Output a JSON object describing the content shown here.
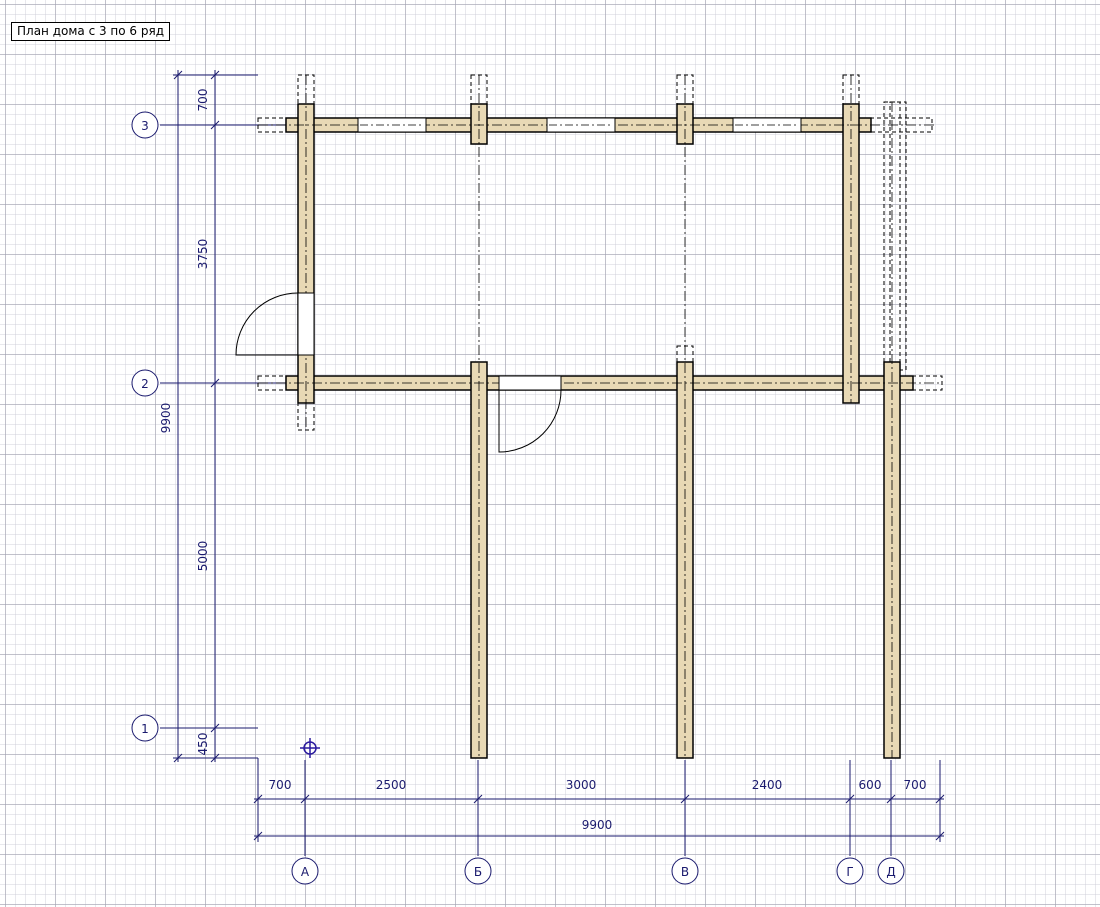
{
  "title": "План дома с 3 по 6 ряд",
  "colors": {
    "dimension_line": "#1a1a6e",
    "log_fill": "#e8d9b5",
    "wall_outline": "#000000",
    "grid_minor": "#cdcdd7",
    "grid_major": "#a0a0af"
  },
  "axes": {
    "rows": [
      "3",
      "2",
      "1"
    ],
    "columns": [
      "А",
      "Б",
      "В",
      "Г",
      "Д"
    ]
  },
  "dimensions": {
    "vertical": {
      "segments": [
        "700",
        "3750",
        "5000",
        "450"
      ],
      "total": "9900"
    },
    "horizontal": {
      "segments": [
        "700",
        "2500",
        "3000",
        "2400",
        "600",
        "700"
      ],
      "total": "9900"
    }
  },
  "elements": {
    "windows": 3,
    "doors": 2,
    "cursor": "crosshair-icon"
  }
}
